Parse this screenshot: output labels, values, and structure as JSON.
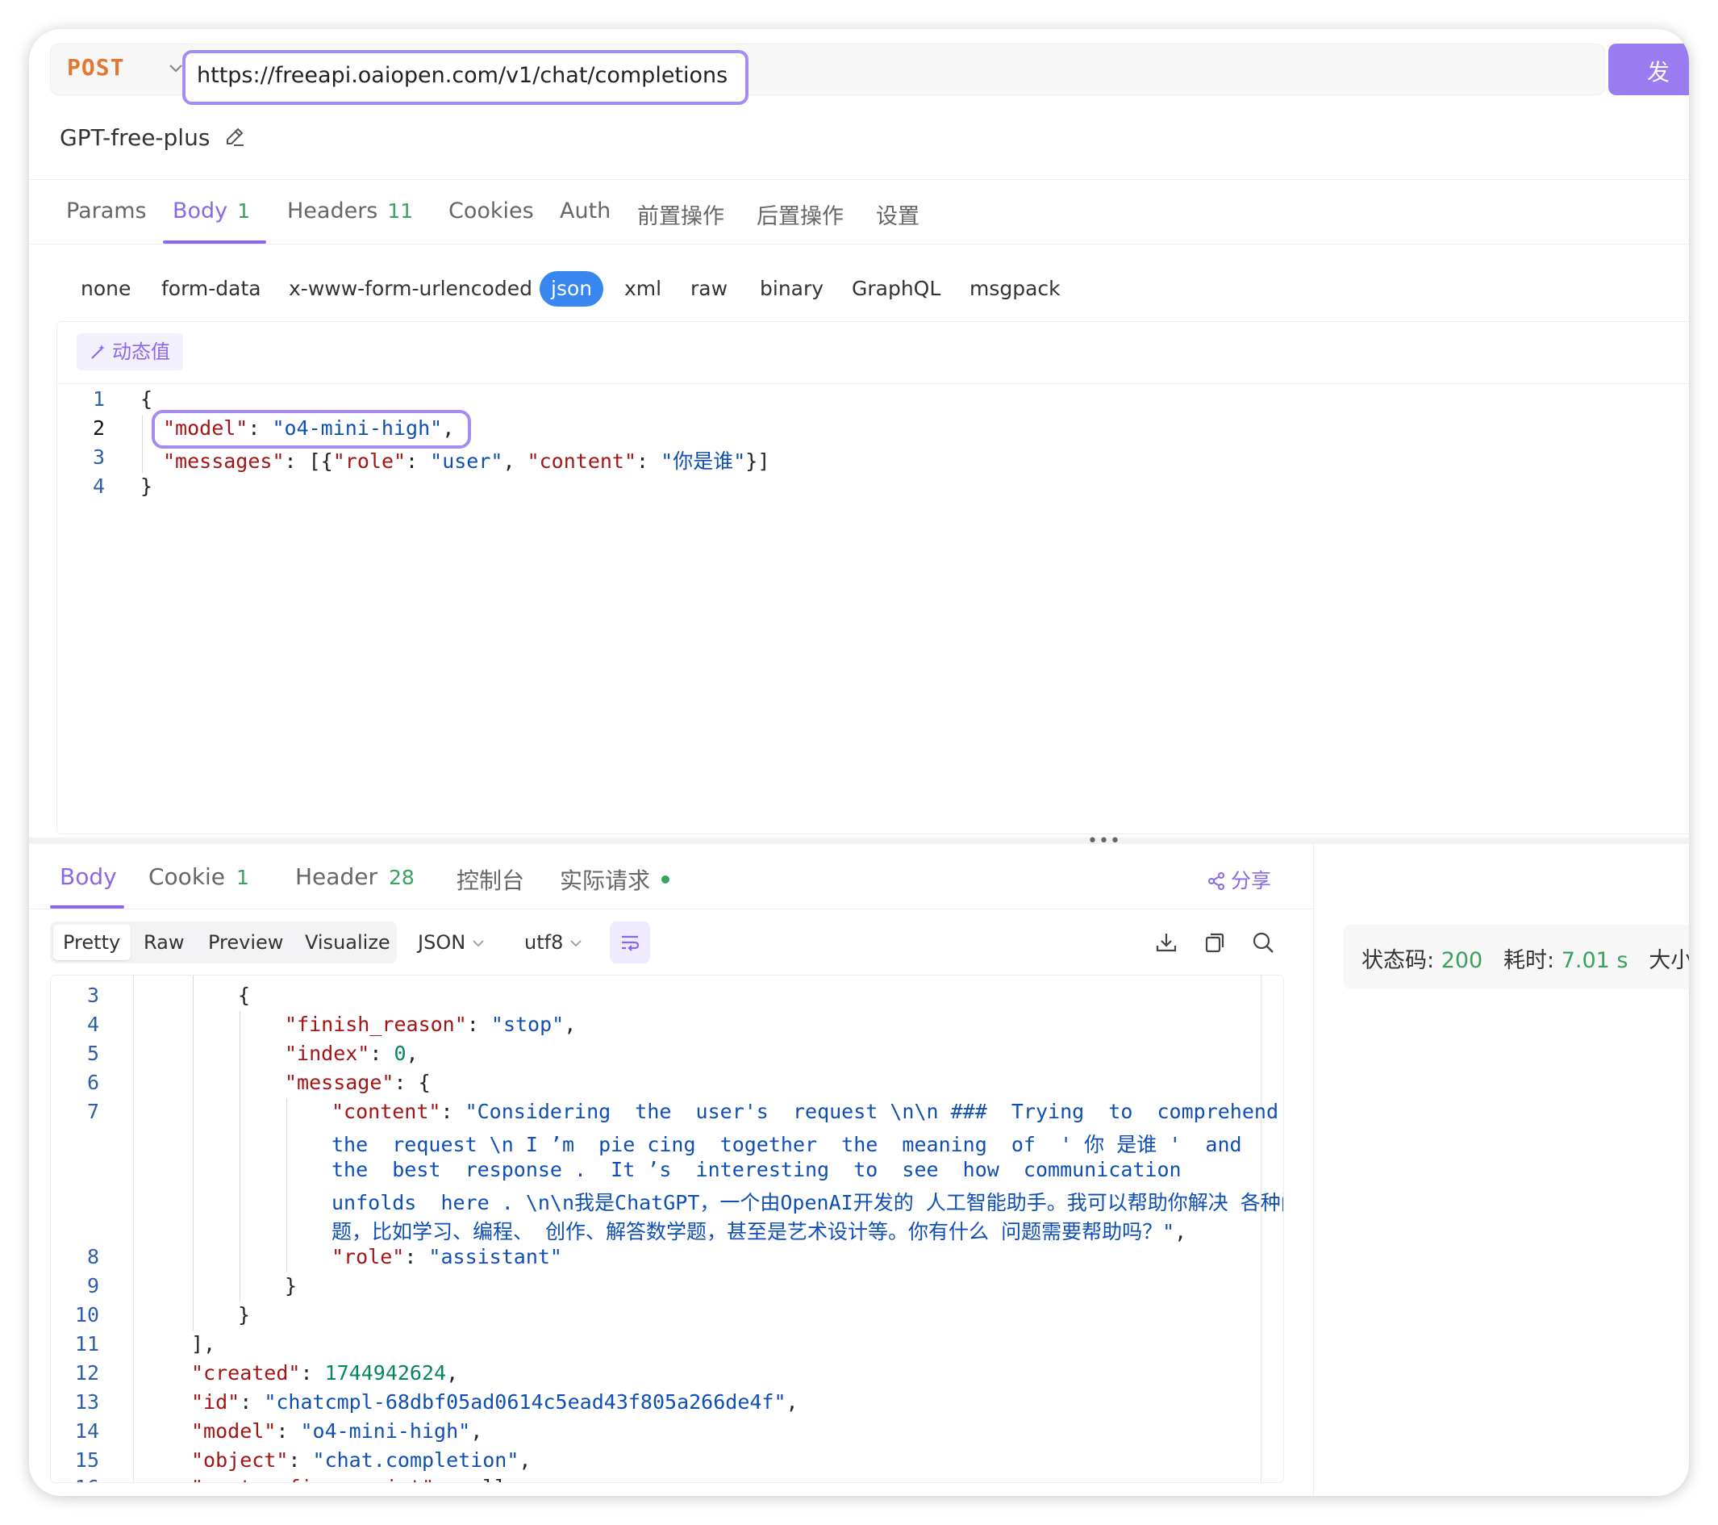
{
  "request": {
    "method": "POST",
    "url": "https://freeapi.oaiopen.com/v1/chat/completions",
    "send_label": "发 送",
    "name": "GPT-free-plus"
  },
  "request_tabs": [
    {
      "label": "Params",
      "count": ""
    },
    {
      "label": "Body",
      "count": "1"
    },
    {
      "label": "Headers",
      "count": "11"
    },
    {
      "label": "Cookies",
      "count": ""
    },
    {
      "label": "Auth",
      "count": ""
    },
    {
      "label": "前置操作",
      "count": ""
    },
    {
      "label": "后置操作",
      "count": ""
    },
    {
      "label": "设置",
      "count": ""
    }
  ],
  "body_types": [
    "none",
    "form-data",
    "x-www-form-urlencoded",
    "json",
    "xml",
    "raw",
    "binary",
    "GraphQL",
    "msgpack"
  ],
  "body_type_selected": "json",
  "dynamic_value_label": "动态值",
  "request_body": {
    "line_numbers": [
      "1",
      "2",
      "3",
      "4"
    ],
    "open": "{",
    "model_key": "\"model\"",
    "model_value": "\"o4-mini-high\"",
    "messages_key": "\"messages\"",
    "role_key": "\"role\"",
    "role_value": "\"user\"",
    "content_key": "\"content\"",
    "content_value": "\"你是谁\"",
    "close": "}"
  },
  "response_tabs": [
    {
      "label": "Body",
      "count": ""
    },
    {
      "label": "Cookie",
      "count": "1"
    },
    {
      "label": "Header",
      "count": "28"
    },
    {
      "label": "控制台",
      "count": ""
    },
    {
      "label": "实际请求",
      "count": ""
    }
  ],
  "share_label": "分享",
  "view_modes": [
    "Pretty",
    "Raw",
    "Preview",
    "Visualize"
  ],
  "format_select": "JSON",
  "encoding_select": "utf8",
  "status": {
    "code_label": "状态码:",
    "code": "200",
    "time_label": "耗时:",
    "time": "7.01 s",
    "size_label": "大小"
  },
  "response_body": {
    "line_numbers": [
      "3",
      "4",
      "5",
      "6",
      "7",
      "",
      "",
      "",
      "",
      "8",
      "9",
      "10",
      "11",
      "12",
      "13",
      "14",
      "15",
      "16"
    ],
    "finish_reason_key": "\"finish_reason\"",
    "finish_reason_value": "\"stop\"",
    "index_key": "\"index\"",
    "index_value": "0",
    "message_key": "\"message\"",
    "content_key": "\"content\"",
    "content_lines": [
      "\"Considering  the  user's  request \\n\\n ###  Trying  to  comprehend",
      "the  request \\n I ’m  pie cing  together  the  meaning  of  ' 你 是谁 '  and",
      "the  best  response .  It ’s  interesting  to  see  how  communication",
      "unfolds  here . \\n\\n我是ChatGPT，一个由OpenAI开发的 人工智能助手。我可以帮助你解决 各种问",
      "题，比如学习、编程、 创作、解答数学题，甚至是艺术设计等。你有什么 问题需要帮助吗？\""
    ],
    "role_key": "\"role\"",
    "role_value": "\"assistant\"",
    "created_key": "\"created\"",
    "created_value": "1744942624",
    "id_key": "\"id\"",
    "id_value": "\"chatcmpl-68dbf05ad0614c5ead43f805a266de4f\"",
    "model_key": "\"model\"",
    "model_value": "\"o4-mini-high\"",
    "object_key": "\"object\"",
    "object_value": "\"chat.completion\"",
    "fingerprint_key": "\"system_fingerprint\"",
    "fingerprint_value": "null"
  },
  "colors": {
    "accent": "#8b68e8",
    "method": "#e4772f",
    "json_selected": "#3a86f0",
    "count_green": "#39a25e",
    "json_key": "#a31515",
    "json_string": "#0f4fb5",
    "json_number": "#098658"
  },
  "icons": [
    "chevron-down-icon",
    "edit-pencil-icon",
    "magic-wand-icon",
    "share-icon",
    "word-wrap-icon",
    "download-icon",
    "copy-icon",
    "search-icon",
    "status-dot-icon"
  ]
}
